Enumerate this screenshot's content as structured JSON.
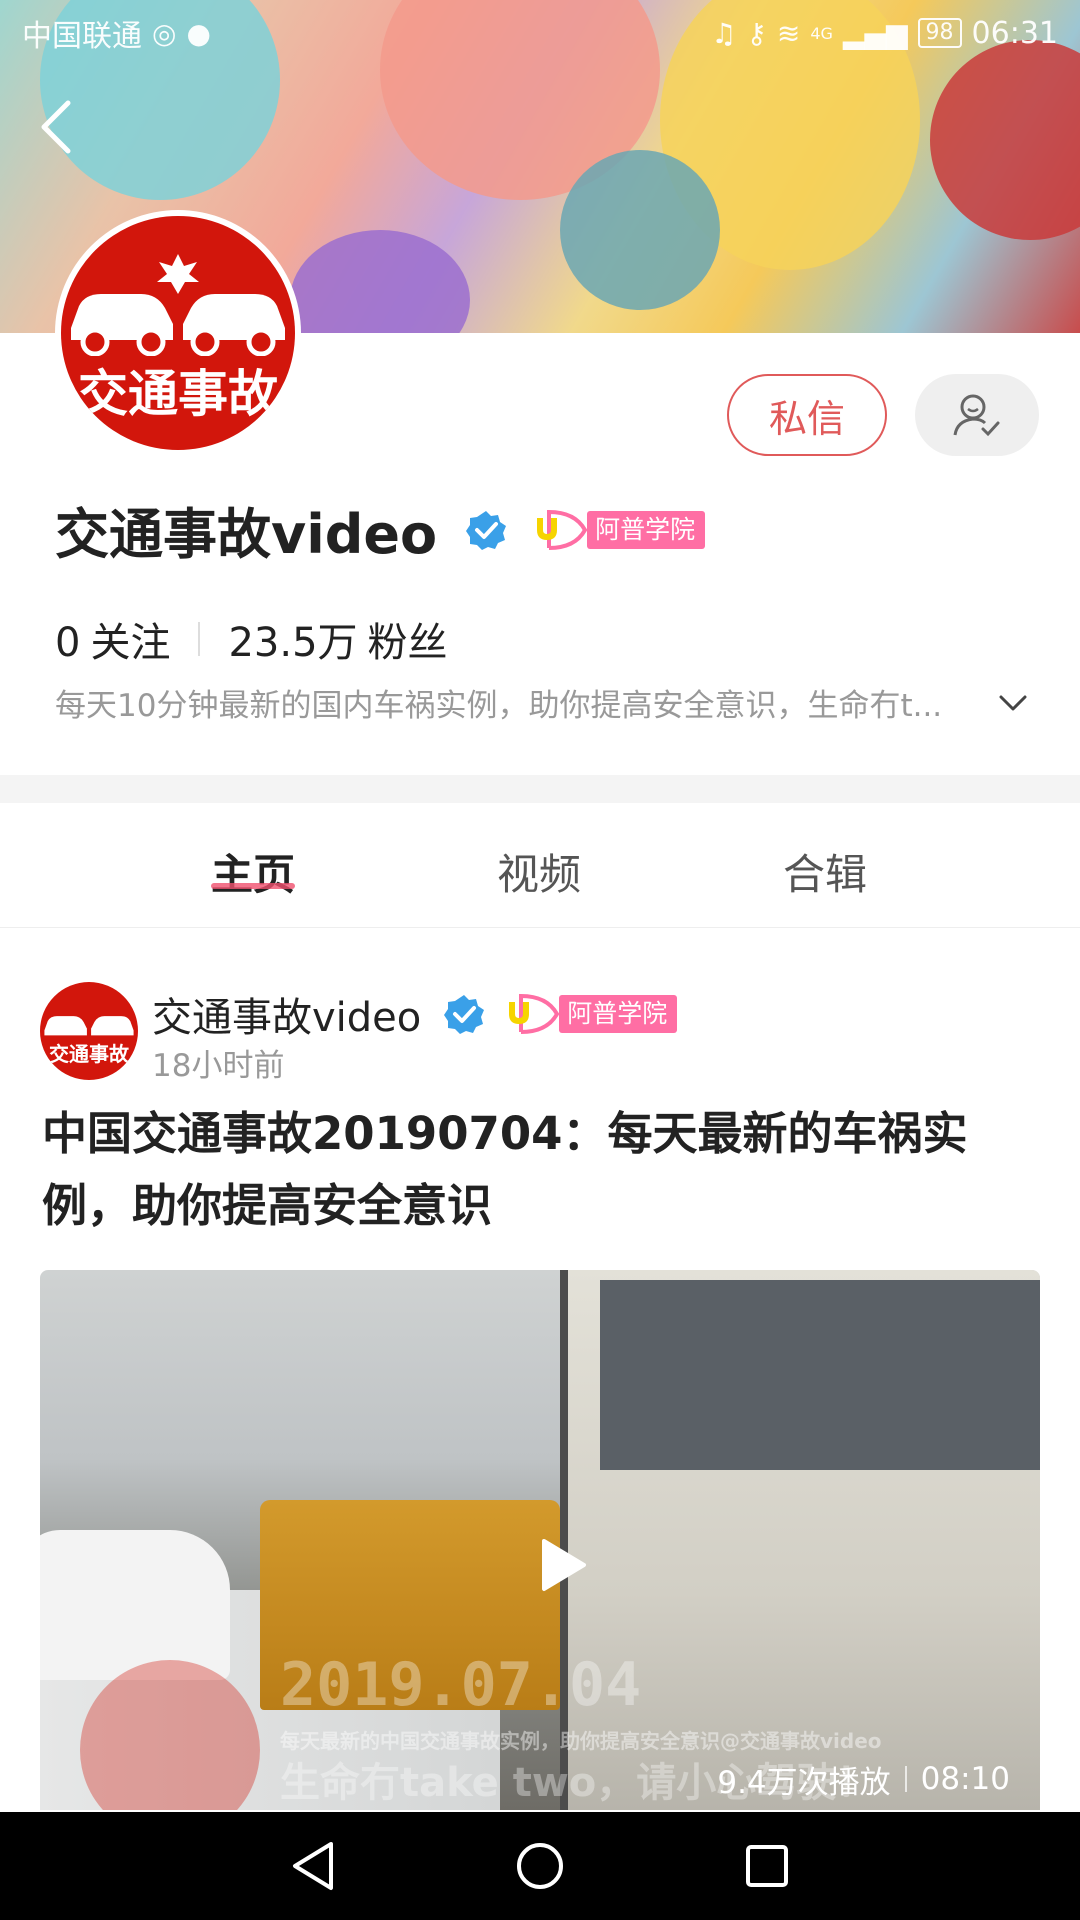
{
  "status_bar": {
    "carrier": "中国联通",
    "time": "06:31",
    "battery": "98",
    "network": "4G"
  },
  "profile": {
    "name": "交通事故video",
    "badge_label": "阿普学院",
    "following_count": "0",
    "following_label": "关注",
    "followers_count": "23.5万",
    "followers_label": "粉丝",
    "bio": "每天10分钟最新的国内车祸实例，助你提高安全意识，生命冇t...",
    "avatar_text": "交通事故",
    "dm_button": "私信"
  },
  "tabs": [
    {
      "label": "主页"
    },
    {
      "label": "视频"
    },
    {
      "label": "合辑"
    }
  ],
  "post": {
    "author": "交通事故video",
    "badge_label": "阿普学院",
    "time": "18小时前",
    "title": "中国交通事故20190704：每天最新的车祸实例，助你提高安全意识",
    "views": "9.4万次播放",
    "duration": "08:10",
    "watermark_date": "2019.07.04",
    "watermark_text": "每天最新的中国交通事故实例，助你提高安全意识@交通事故video",
    "watermark_text2": "生命冇take two，请小心驾驶！"
  },
  "colors": {
    "accent": "#e05a5a",
    "avatar_red": "#d2160c",
    "badge_pink": "#ff6ea4",
    "verified_blue": "#3aa0e8"
  },
  "icons": {
    "back": "chevron-left-icon",
    "follow": "user-check-icon",
    "verified": "verified-icon",
    "expand": "chevron-down-icon",
    "play": "play-icon"
  }
}
